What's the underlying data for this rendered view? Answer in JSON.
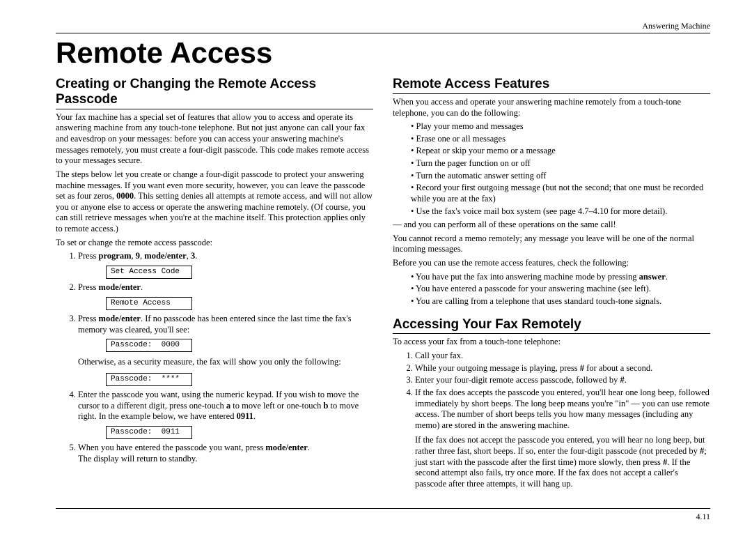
{
  "header": {
    "right": "Answering Machine"
  },
  "title": "Remote Access",
  "left": {
    "h1": "Creating or Changing the Remote Access Passcode",
    "p1": "Your fax machine has a special set of features that allow you to access and operate its answering machine from any touch-tone telephone. But not just anyone can call your fax and eavesdrop on your messages: before you can access your answering machine's messages remotely, you must create a four-digit passcode. This code makes remote access to your messages secure.",
    "p2_a": "The steps below let you create or change a four-digit passcode to protect your answering machine messages. If you want even more security, however, you can leave the passcode set as four zeros, ",
    "p2_b": "0000",
    "p2_c": ". This setting denies all attempts at remote access, and will not allow you or anyone else to access or operate the answering machine remotely. (Of course, you can still retrieve messages when you're at the machine itself. This protection applies only to remote access.)",
    "p3": "To set or change the remote access passcode:",
    "s1_a": "Press ",
    "s1_b": "program",
    "s1_c": ", ",
    "s1_d": "9",
    "s1_e": ", ",
    "s1_f": "mode/enter",
    "s1_g": ", ",
    "s1_h": "3",
    "s1_i": ".",
    "lcd1": "Set Access Code",
    "s2_a": "Press ",
    "s2_b": "mode/enter",
    "s2_c": ".",
    "lcd2": "Remote Access",
    "s3_a": "Press ",
    "s3_b": "mode/enter",
    "s3_c": ". If no passcode has been entered since the last time the fax's memory was cleared, you'll see:",
    "lcd3": "Passcode:  0000",
    "s3_d": "Otherwise, as a security measure, the fax will show you only the following:",
    "lcd4": "Passcode:  ****",
    "s4_a": "Enter the passcode you want, using the numeric keypad. If you wish to move the cursor to a different digit, press one-touch ",
    "s4_b": "a",
    "s4_c": " to move left or one-touch ",
    "s4_d": "b",
    "s4_e": " to move right. In the example below, we have entered ",
    "s4_f": "0911",
    "s4_g": ".",
    "lcd5": "Passcode:  0911",
    "s5_a": "When you have entered the passcode you want, press ",
    "s5_b": "mode/enter",
    "s5_c": ".",
    "s5_d": "The display will return to standby."
  },
  "right": {
    "h1": "Remote Access Features",
    "p1": "When you access and operate your answering machine remotely from a touch-tone telephone, you can do the following:",
    "b1": "Play your memo and messages",
    "b2": "Erase one or all messages",
    "b3": "Repeat or skip your memo or a message",
    "b4": "Turn the pager function on or off",
    "b5": "Turn the automatic answer setting off",
    "b6": "Record your first outgoing message (but not the second; that one must be recorded while you are at the fax)",
    "b7": "Use the fax's voice mail box system (see page 4.7–4.10 for more detail).",
    "p2": "— and you can perform all of these operations on the same call!",
    "p3": "You cannot record a memo remotely; any message you leave will be one of the normal incoming messages.",
    "p4": "Before you can use the remote access features, check the following:",
    "c1_a": "You have put the fax into answering machine mode by pressing ",
    "c1_b": "answer",
    "c1_c": ".",
    "c2": "You have entered a passcode for your answering machine (see left).",
    "c3": "You are calling from a telephone that uses standard touch-tone signals.",
    "h2": "Accessing Your Fax Remotely",
    "p5": "To access your fax from a touch-tone telephone:",
    "a1": "Call your fax.",
    "a2_a": "While your outgoing message is playing, press ",
    "a2_b": "#",
    "a2_c": " for about a second.",
    "a3_a": "Enter your four-digit remote access passcode, followed by ",
    "a3_b": "#",
    "a3_c": ".",
    "a4": "If the fax does accepts the passcode you entered, you'll hear one long beep, followed immediately by short beeps. The long beep means you're \"in\" — you can use remote access. The number of short beeps tells you how many messages (including any memo) are stored in the answering machine.",
    "a4b_a": "If the fax does not accept the passcode you entered, you will hear no long beep, but rather three fast, short beeps. If so, enter the four-digit passcode (not preceded by ",
    "a4b_b": "#",
    "a4b_c": "; just start with the passcode after the first time) more slowly, then press ",
    "a4b_d": "#",
    "a4b_e": ". If the second attempt also fails, try once more. If the fax does not accept a caller's passcode after three attempts, it will hang up."
  },
  "footer": {
    "page": "4.11"
  }
}
